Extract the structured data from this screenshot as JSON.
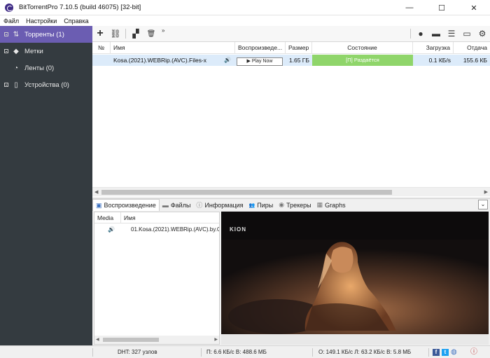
{
  "window": {
    "title": "BitTorrentPro 7.10.5  (build 46075) [32-bit]",
    "minimize": "—",
    "maximize": "☐",
    "close": "✕"
  },
  "menu": [
    "Файл",
    "Настройки",
    "Справка"
  ],
  "sidebar": {
    "items": [
      {
        "label": "Торренты (1)",
        "icon": "transfer-arrows-icon",
        "glyph": "⇅",
        "active": true,
        "expander": true
      },
      {
        "label": "Метки",
        "icon": "tag-icon",
        "glyph": "◆",
        "active": false,
        "expander": true
      },
      {
        "label": "Ленты (0)",
        "icon": "rss-icon",
        "glyph": "◔",
        "active": false,
        "expander": false
      },
      {
        "label": "Устройства (0)",
        "icon": "phone-icon",
        "glyph": "▯",
        "active": false,
        "expander": true
      }
    ]
  },
  "toolbar": {
    "add": "+",
    "link": "⛓",
    "create": "▞",
    "delete": "🗑",
    "overflow": "»",
    "bulb": "●",
    "chat": "▬",
    "list": "☰",
    "monitor": "▭",
    "settings": "⚙"
  },
  "torrent_list": {
    "columns": [
      "№",
      "Имя",
      "Воспроизведе...",
      "Размер",
      "Состояние",
      "Загрузка",
      "Отдача"
    ],
    "rows": [
      {
        "num": "",
        "name": "Kosa.(2021).WEBRip.(AVC).Files-x",
        "audio": "🔊",
        "play": "▶ Play Now",
        "size": "1.65 ГБ",
        "status": "[П] Раздаётся",
        "down": "0.1 КБ/s",
        "up": "155.6 КБ"
      }
    ]
  },
  "bottom_tabs": [
    {
      "label": "Воспроизведение",
      "icon": "play-icon",
      "glyph": "▣",
      "active": true
    },
    {
      "label": "Файлы",
      "icon": "folder-icon",
      "glyph": "▬",
      "active": false
    },
    {
      "label": "Информация",
      "icon": "info-icon",
      "glyph": "ⓘ",
      "active": false
    },
    {
      "label": "Пиры",
      "icon": "peers-icon",
      "glyph": "👥",
      "active": false
    },
    {
      "label": "Трекеры",
      "icon": "tracker-icon",
      "glyph": "◉",
      "active": false
    },
    {
      "label": "Graphs",
      "icon": "graph-icon",
      "glyph": "▦",
      "active": false
    }
  ],
  "collapse": "⌄",
  "files": {
    "columns": [
      "Media",
      "Имя"
    ],
    "rows": [
      {
        "media": "🔊",
        "name": "01.Kosa.(2021).WEBRip.(AVC).by.C"
      }
    ]
  },
  "video": {
    "logo": "KION"
  },
  "statusbar": {
    "dht": "DHT: 327 узлов",
    "download": "П: 6.6 КБ/с В: 488.6 МБ",
    "upload": "О: 149.1 КБ/с Л: 63.2 КБ/с В: 5.8 МБ",
    "facebook": "f",
    "twitter": "t",
    "web": "◍",
    "info": "ⓘ"
  },
  "colors": {
    "sidebar_bg": "#343b40",
    "sidebar_active": "#6b5db2",
    "selected_row": "#dcebfa",
    "status_green": "#8fd56a"
  }
}
